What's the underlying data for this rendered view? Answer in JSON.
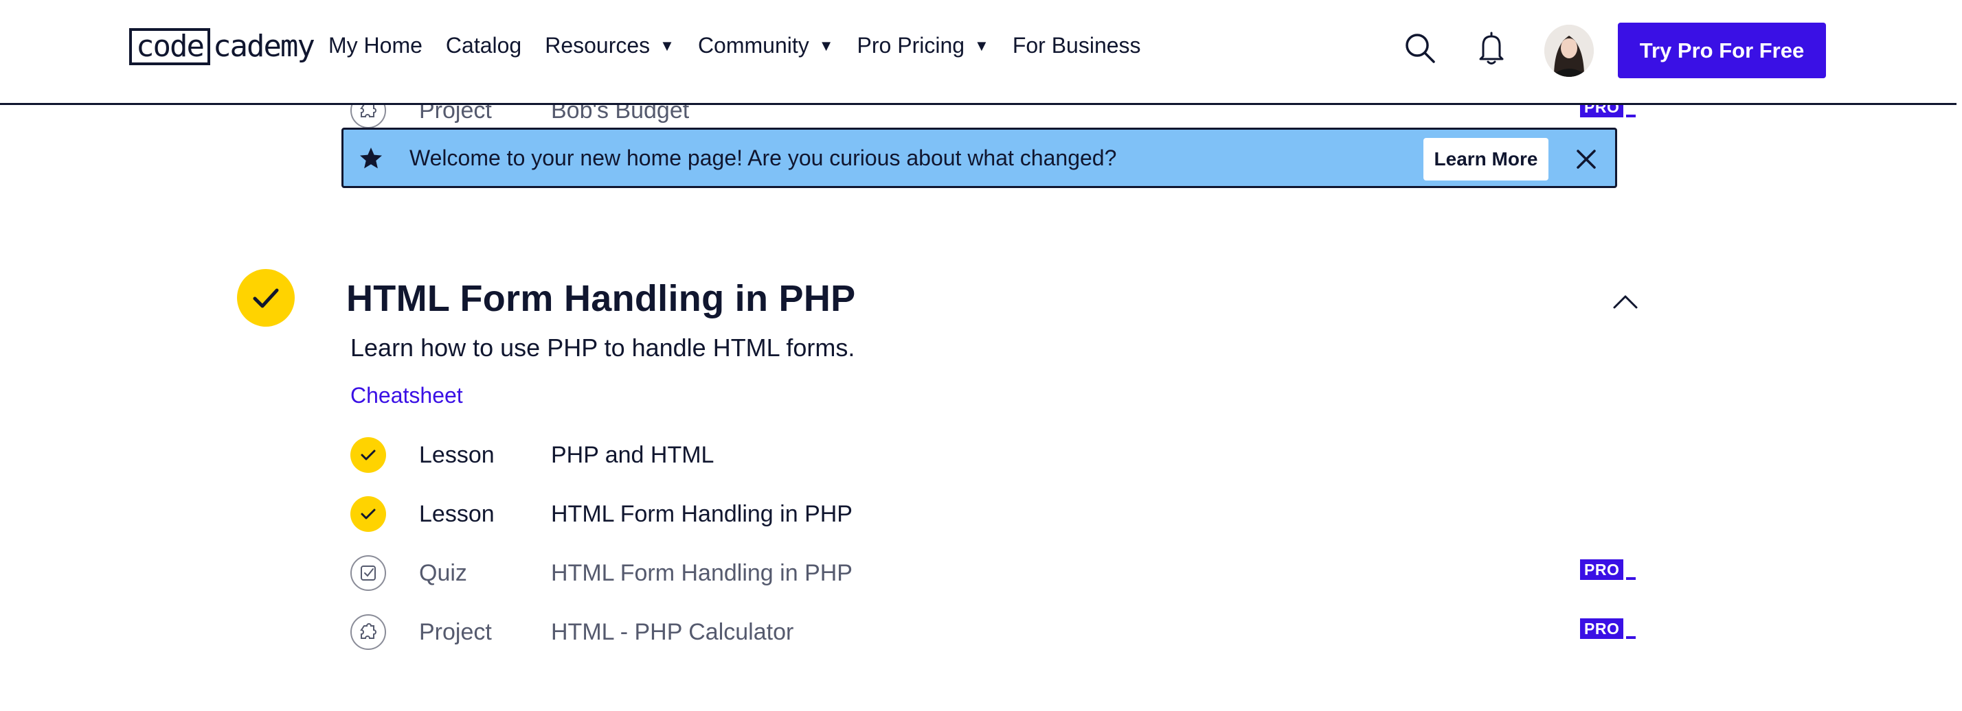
{
  "header": {
    "logo": {
      "boxed": "code",
      "rest": "cademy"
    },
    "nav": [
      {
        "label": "My Home",
        "dropdown": false
      },
      {
        "label": "Catalog",
        "dropdown": false
      },
      {
        "label": "Resources",
        "dropdown": true
      },
      {
        "label": "Community",
        "dropdown": true
      },
      {
        "label": "Pro Pricing",
        "dropdown": true
      },
      {
        "label": "For Business",
        "dropdown": false
      }
    ],
    "caret": "▼",
    "icons": [
      "search-icon",
      "bell-icon"
    ],
    "cta": "Try Pro For Free"
  },
  "scrolled_row": {
    "type": "Project",
    "title": "Bob's Budget",
    "pro": "PRO"
  },
  "banner": {
    "message": "Welcome to your new home page! Are you curious about what changed?",
    "button": "Learn More",
    "icons": [
      "star-icon",
      "close-icon"
    ]
  },
  "module": {
    "title": "HTML Form Handling in PHP",
    "description": "Learn how to use PHP to handle HTML forms.",
    "cheatsheet": "Cheatsheet",
    "items": [
      {
        "type": "Lesson",
        "title": "PHP and HTML",
        "status": "complete"
      },
      {
        "type": "Lesson",
        "title": "HTML Form Handling in PHP",
        "status": "complete"
      },
      {
        "type": "Quiz",
        "title": "HTML Form Handling in PHP",
        "status": "locked",
        "pro": "PRO"
      },
      {
        "type": "Project",
        "title": "HTML - PHP Calculator",
        "status": "locked",
        "pro": "PRO"
      }
    ]
  },
  "colors": {
    "brand": "#3a10e5",
    "navy": "#10162f",
    "check_yellow": "#ffd300",
    "banner_blue": "#7fc1f7"
  }
}
